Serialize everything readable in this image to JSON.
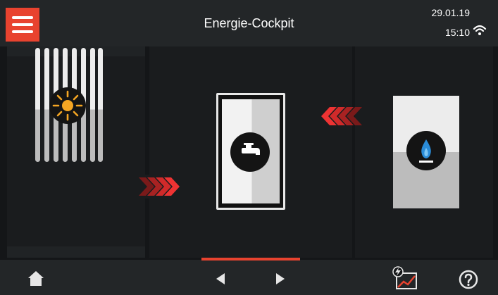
{
  "header": {
    "menu_icon": "hamburger-menu-icon",
    "title": "Energie-Cockpit",
    "date": "29.01.19",
    "time": "15:10",
    "wifi_icon": "wifi-icon"
  },
  "flow": {
    "source_left": {
      "icon": "sun-icon",
      "device_icon": "radiator-icon"
    },
    "storage": {
      "icon": "water-tap-icon",
      "device_icon": "hot-water-tank-icon"
    },
    "source_right": {
      "icon": "gas-flame-icon",
      "device_icon": "gas-boiler-icon"
    },
    "arrows": [
      "flow-arrows-right-icon",
      "flow-arrows-left-icon"
    ]
  },
  "footer": {
    "home_icon": "home-icon",
    "prev_icon": "previous-arrow-icon",
    "next_icon": "next-arrow-icon",
    "energy_icon": "energy-chart-icon",
    "help_icon": "help-icon"
  },
  "colors": {
    "accent": "#e8432f",
    "arrow_red": "#d92d2d",
    "flame_blue": "#2a8cd8",
    "sun_orange": "#f5a623"
  }
}
